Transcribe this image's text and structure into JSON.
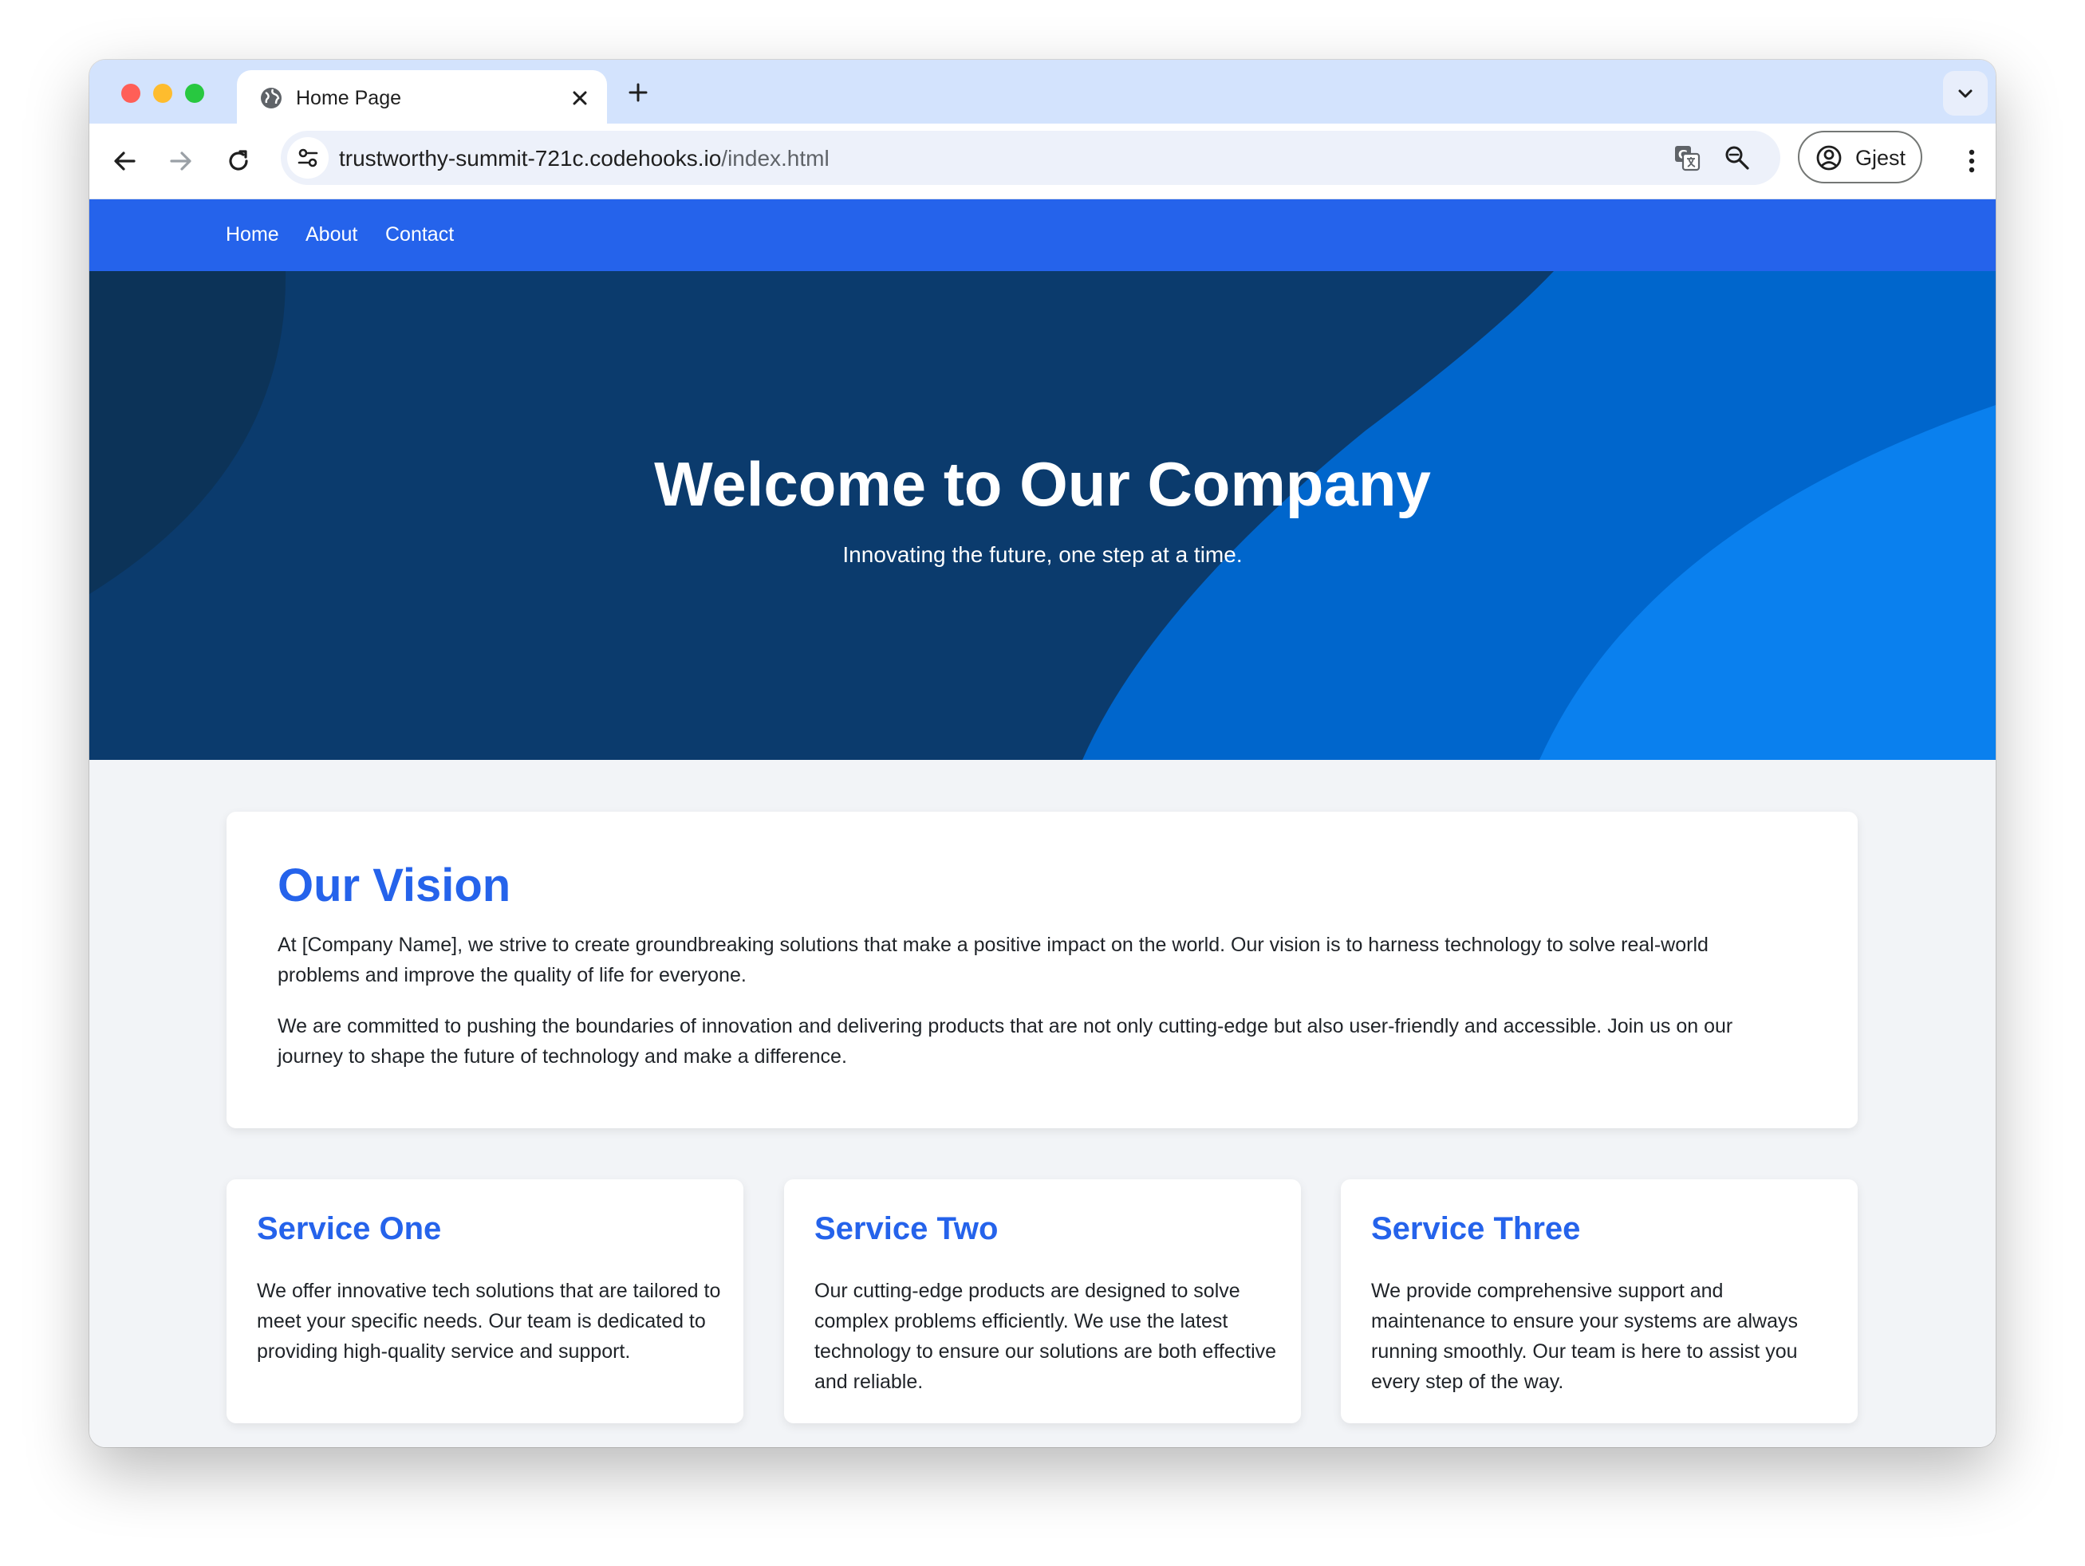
{
  "browser": {
    "tab_title": "Home Page",
    "url_host": "trustworthy-summit-721c.codehooks.io",
    "url_path": "/index.html",
    "profile_label": "Gjest"
  },
  "nav": {
    "items": [
      {
        "label": "Home"
      },
      {
        "label": "About"
      },
      {
        "label": "Contact"
      }
    ]
  },
  "hero": {
    "title": "Welcome to Our Company",
    "subtitle": "Innovating the future, one step at a time."
  },
  "vision": {
    "heading": "Our Vision",
    "paragraphs": [
      "At [Company Name], we strive to create groundbreaking solutions that make a positive impact on the world. Our vision is to harness technology to solve real-world problems and improve the quality of life for everyone.",
      "We are committed to pushing the boundaries of innovation and delivering products that are not only cutting-edge but also user-friendly and accessible. Join us on our journey to shape the future of technology and make a difference."
    ]
  },
  "services": [
    {
      "title": "Service One",
      "text": "We offer innovative tech solutions that are tailored to meet your specific needs. Our team is dedicated to providing high-quality service and support."
    },
    {
      "title": "Service Two",
      "text": "Our cutting-edge products are designed to solve complex problems efficiently. We use the latest technology to ensure our solutions are both effective and reliable."
    },
    {
      "title": "Service Three",
      "text": "We provide comprehensive support and maintenance to ensure your systems are always running smoothly. Our team is here to assist you every step of the way."
    }
  ],
  "colors": {
    "brand_blue": "#2563eb",
    "hero_dark": "#0b3b6d",
    "hero_mid": "#0066cc",
    "hero_light": "#0a80ee"
  },
  "icons": {
    "tab": "globe-icon",
    "close": "close-icon",
    "new_tab": "plus-icon",
    "back": "arrow-left-icon",
    "forward": "arrow-right-icon",
    "reload": "reload-icon",
    "site_info": "tune-icon",
    "translate": "translate-icon",
    "zoom": "zoom-out-icon",
    "profile": "account-circle-icon",
    "menu": "more-vert-icon"
  }
}
